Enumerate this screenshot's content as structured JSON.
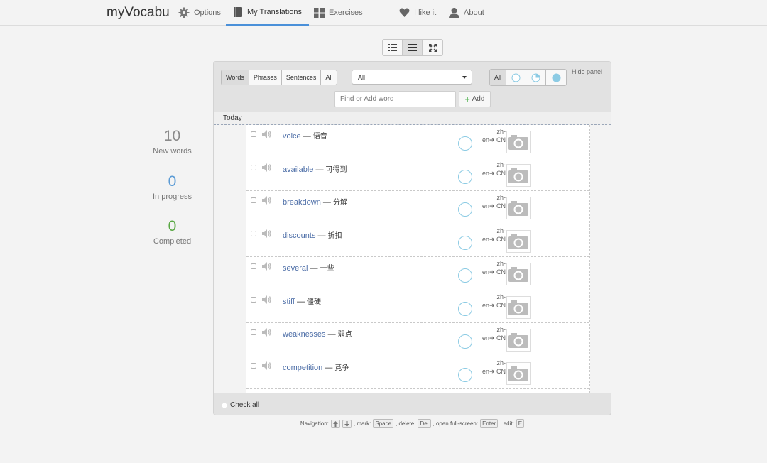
{
  "brand": "myVocabu",
  "nav": {
    "options": "Options",
    "my_translations": "My Translations",
    "exercises": "Exercises",
    "i_like_it": "I like it",
    "about": "About"
  },
  "stats": {
    "new_words": {
      "value": "10",
      "label": "New words",
      "color": "#8a8a8a"
    },
    "in_progress": {
      "value": "0",
      "label": "In progress",
      "color": "#5b9bd5"
    },
    "completed": {
      "value": "0",
      "label": "Completed",
      "color": "#5aa845"
    }
  },
  "filters": {
    "type_tabs": [
      "Words",
      "Phrases",
      "Sentences",
      "All"
    ],
    "active_type": "Words",
    "dropdown_value": "All",
    "status_all": "All",
    "hide_panel": "Hide panel"
  },
  "search": {
    "placeholder": "Find or Add word",
    "add_label": "Add"
  },
  "group_title": "Today",
  "words": [
    {
      "word": "voice",
      "translation": "语音",
      "lang_top": "zh-",
      "lang_bottom": "en➔ CN"
    },
    {
      "word": "available",
      "translation": "可得到",
      "lang_top": "zh-",
      "lang_bottom": "en➔ CN"
    },
    {
      "word": "breakdown",
      "translation": "分解",
      "lang_top": "zh-",
      "lang_bottom": "en➔ CN"
    },
    {
      "word": "discounts",
      "translation": "折扣",
      "lang_top": "zh-",
      "lang_bottom": "en➔ CN"
    },
    {
      "word": "several",
      "translation": "一些",
      "lang_top": "zh-",
      "lang_bottom": "en➔ CN"
    },
    {
      "word": "stiff",
      "translation": "僵硬",
      "lang_top": "zh-",
      "lang_bottom": "en➔ CN"
    },
    {
      "word": "weaknesses",
      "translation": "弱点",
      "lang_top": "zh-",
      "lang_bottom": "en➔ CN"
    },
    {
      "word": "competition",
      "translation": "竞争",
      "lang_top": "zh-",
      "lang_bottom": "en➔ CN"
    }
  ],
  "dash": "—",
  "check_all": "Check all",
  "help": {
    "navigation": "Navigation:",
    "mark": ", mark:",
    "space": "Space",
    "delete": ", delete:",
    "del": "Del",
    "fullscreen": ", open full-screen:",
    "enter": "Enter",
    "edit": ", edit:",
    "e": "E"
  },
  "colors": {
    "accent": "#4a90d9",
    "word_link": "#4d6ea7",
    "status_circle": "#8ccbe4"
  }
}
